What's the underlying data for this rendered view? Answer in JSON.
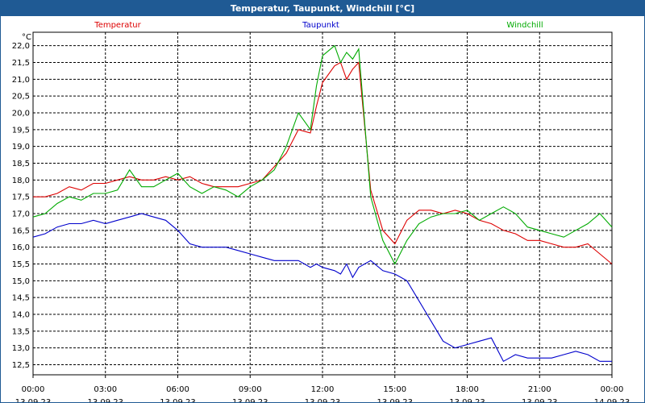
{
  "window": {
    "title": "Temperatur, Taupunkt, Windchill [°C]"
  },
  "chart_data": {
    "type": "line",
    "title": "Temperatur, Taupunkt, Windchill [°C]",
    "unit_label": "°C",
    "xlabel": "",
    "ylabel": "°C",
    "xlim": [
      "13.09.23 00:00",
      "14.09.23 00:00"
    ],
    "ylim": [
      12.2,
      22.4
    ],
    "y_ticks": [
      "12,5",
      "13,0",
      "13,5",
      "14,0",
      "14,5",
      "15,0",
      "15,5",
      "16,0",
      "16,5",
      "17,0",
      "17,5",
      "18,0",
      "18,5",
      "19,0",
      "19,5",
      "20,0",
      "20,5",
      "21,0",
      "21,5",
      "22,0"
    ],
    "x_ticks": [
      {
        "time": "00:00",
        "date": "13.09.23"
      },
      {
        "time": "03:00",
        "date": "13.09.23"
      },
      {
        "time": "06:00",
        "date": "13.09.23"
      },
      {
        "time": "09:00",
        "date": "13.09.23"
      },
      {
        "time": "12:00",
        "date": "13.09.23"
      },
      {
        "time": "15:00",
        "date": "13.09.23"
      },
      {
        "time": "18:00",
        "date": "13.09.23"
      },
      {
        "time": "21:00",
        "date": "13.09.23"
      },
      {
        "time": "00:00",
        "date": "14.09.23"
      }
    ],
    "grid": true,
    "legend_placement": "top",
    "x_hours": [
      0,
      0.5,
      1,
      1.5,
      2,
      2.5,
      3,
      3.5,
      4,
      4.5,
      5,
      5.5,
      6,
      6.5,
      7,
      7.5,
      8,
      8.5,
      9,
      9.5,
      10,
      10.5,
      11,
      11.5,
      11.75,
      12,
      12.5,
      12.75,
      13,
      13.25,
      13.5,
      14,
      14.5,
      15,
      15.5,
      16,
      16.5,
      17,
      17.5,
      18,
      18.5,
      19,
      19.5,
      20,
      20.5,
      21,
      21.5,
      22,
      22.5,
      23,
      23.5,
      24
    ],
    "series": [
      {
        "name": "Temperatur",
        "color": "#dd0000",
        "values": [
          17.5,
          17.5,
          17.6,
          17.8,
          17.7,
          17.9,
          17.9,
          18.0,
          18.1,
          18.0,
          18.0,
          18.1,
          18.0,
          18.1,
          17.9,
          17.8,
          17.8,
          17.8,
          17.9,
          18.0,
          18.4,
          18.8,
          19.5,
          19.4,
          20.2,
          20.9,
          21.4,
          21.5,
          21.0,
          21.3,
          21.5,
          17.7,
          16.5,
          16.1,
          16.8,
          17.1,
          17.1,
          17.0,
          17.1,
          17.0,
          16.8,
          16.7,
          16.5,
          16.4,
          16.2,
          16.2,
          16.1,
          16.0,
          16.0,
          16.1,
          15.8,
          15.5
        ]
      },
      {
        "name": "Taupunkt",
        "color": "#0000cc",
        "values": [
          16.3,
          16.4,
          16.6,
          16.7,
          16.7,
          16.8,
          16.7,
          16.8,
          16.9,
          17.0,
          16.9,
          16.8,
          16.5,
          16.1,
          16.0,
          16.0,
          16.0,
          15.9,
          15.8,
          15.7,
          15.6,
          15.6,
          15.6,
          15.4,
          15.5,
          15.4,
          15.3,
          15.2,
          15.5,
          15.1,
          15.4,
          15.6,
          15.3,
          15.2,
          15.0,
          14.4,
          13.8,
          13.2,
          13.0,
          13.1,
          13.2,
          13.3,
          12.6,
          12.8,
          12.7,
          12.7,
          12.7,
          12.8,
          12.9,
          12.8,
          12.6,
          12.6
        ]
      },
      {
        "name": "Windchill",
        "color": "#00aa00",
        "values": [
          16.9,
          17.0,
          17.3,
          17.5,
          17.4,
          17.6,
          17.6,
          17.7,
          18.3,
          17.8,
          17.8,
          18.0,
          18.2,
          17.8,
          17.6,
          17.8,
          17.7,
          17.5,
          17.8,
          18.0,
          18.3,
          19.0,
          20.0,
          19.5,
          20.8,
          21.7,
          22.0,
          21.5,
          21.8,
          21.6,
          21.9,
          17.5,
          16.2,
          15.5,
          16.2,
          16.7,
          16.9,
          17.0,
          17.0,
          17.1,
          16.8,
          17.0,
          17.2,
          17.0,
          16.6,
          16.5,
          16.4,
          16.3,
          16.5,
          16.7,
          17.0,
          16.6
        ]
      }
    ]
  }
}
